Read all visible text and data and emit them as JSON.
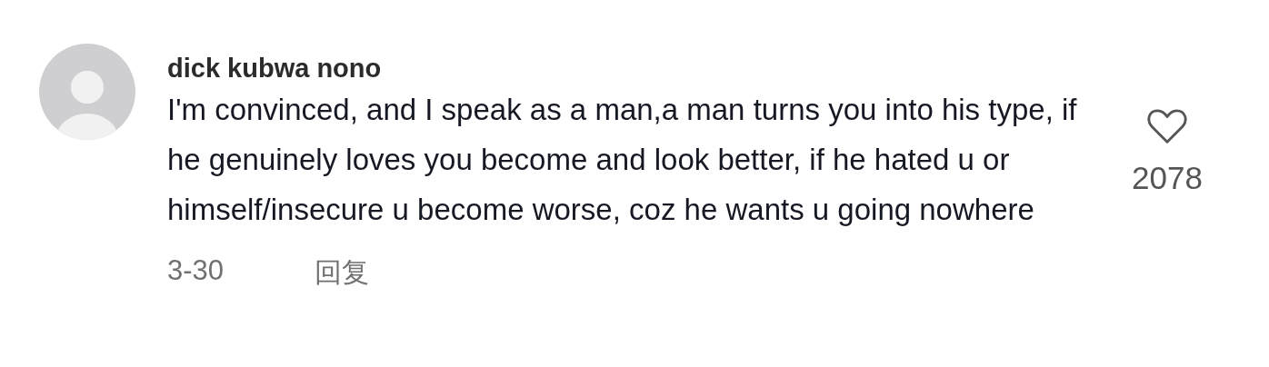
{
  "comment": {
    "author": "dick kubwa nono",
    "text": "I'm convinced, and I speak as a man,a man turns you into his type, if he genuinely loves you become and look better, if he hated u or himself/insecure u become worse, coz he wants u going nowhere",
    "date": "3-30",
    "reply": "回复",
    "likes": {
      "count": "2078",
      "liked": false
    }
  }
}
